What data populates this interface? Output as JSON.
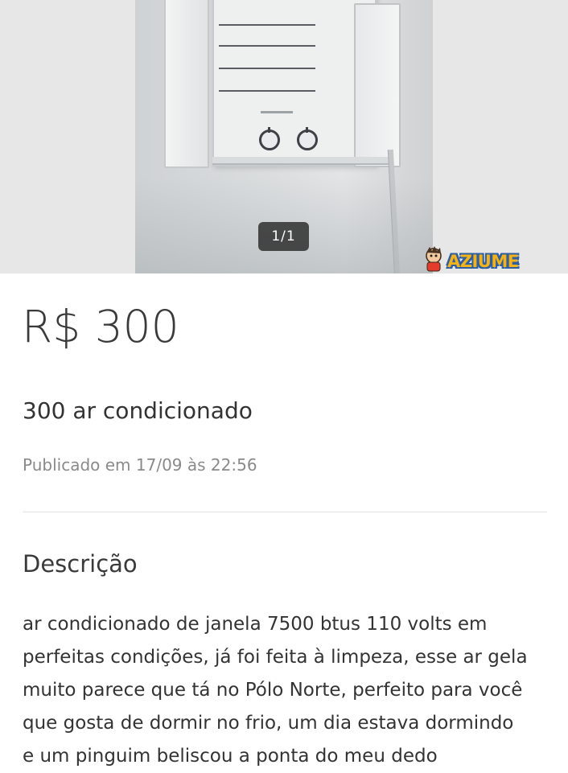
{
  "gallery": {
    "counter": "1/1",
    "watermark": "AZIUME"
  },
  "listing": {
    "price": "R$ 300",
    "title": "300 ar condicionado",
    "posted": "Publicado em 17/09 às 22:56"
  },
  "description": {
    "heading": "Descrição",
    "lines": [
      "ar condicionado de janela 7500 btus 110 volts em",
      "perfeitas condições, já foi feita à limpeza, esse ar gela",
      "muito parece que tá no Pólo Norte, perfeito para você",
      "que gosta de dormir no frio, um dia estava dormindo",
      "e um pinguim beliscou a ponta do meu dedo"
    ]
  }
}
